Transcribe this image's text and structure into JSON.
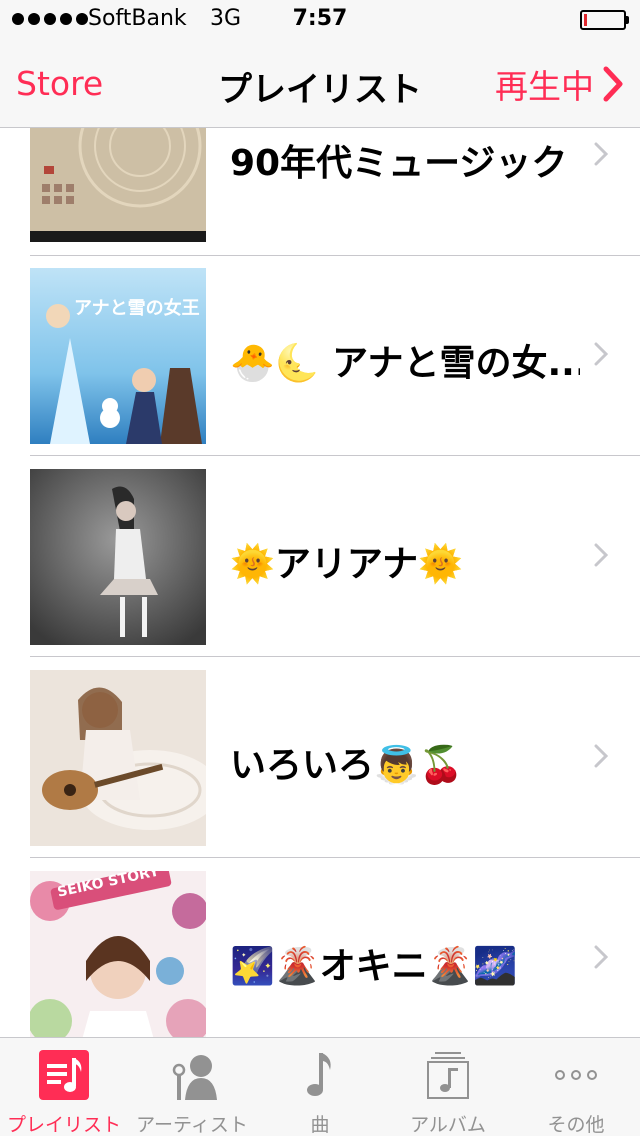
{
  "status_bar": {
    "carrier": "SoftBank",
    "network": "3G",
    "time": "7:57",
    "signal_bars": 5,
    "battery_level": 0.08
  },
  "nav": {
    "back_label": "Store",
    "title": "プレイリスト",
    "right_label": "再生中",
    "accent_color": "#ff2d55"
  },
  "playlists": [
    {
      "title": "90年代ミュージック",
      "artwork": "beige-circle-cover"
    },
    {
      "title": "🐣🌜 アナと雪の女...",
      "artwork": "frozen-cover",
      "artwork_text": "アナと雪の女王"
    },
    {
      "title": "🌞アリアナ🌞",
      "artwork": "ariana-grande-cover"
    },
    {
      "title": "いろいろ👼🍒",
      "artwork": "guitar-portrait-cover"
    },
    {
      "title": "🌠🌋オキニ🌋🌌",
      "artwork": "seiko-story-cover",
      "artwork_text": "SEIKO STORY"
    }
  ],
  "tabs": [
    {
      "label": "プレイリスト",
      "icon": "playlist-icon",
      "active": true
    },
    {
      "label": "アーティスト",
      "icon": "artist-icon",
      "active": false
    },
    {
      "label": "曲",
      "icon": "music-note-icon",
      "active": false
    },
    {
      "label": "アルバム",
      "icon": "album-icon",
      "active": false
    },
    {
      "label": "その他",
      "icon": "more-icon",
      "active": false
    }
  ]
}
